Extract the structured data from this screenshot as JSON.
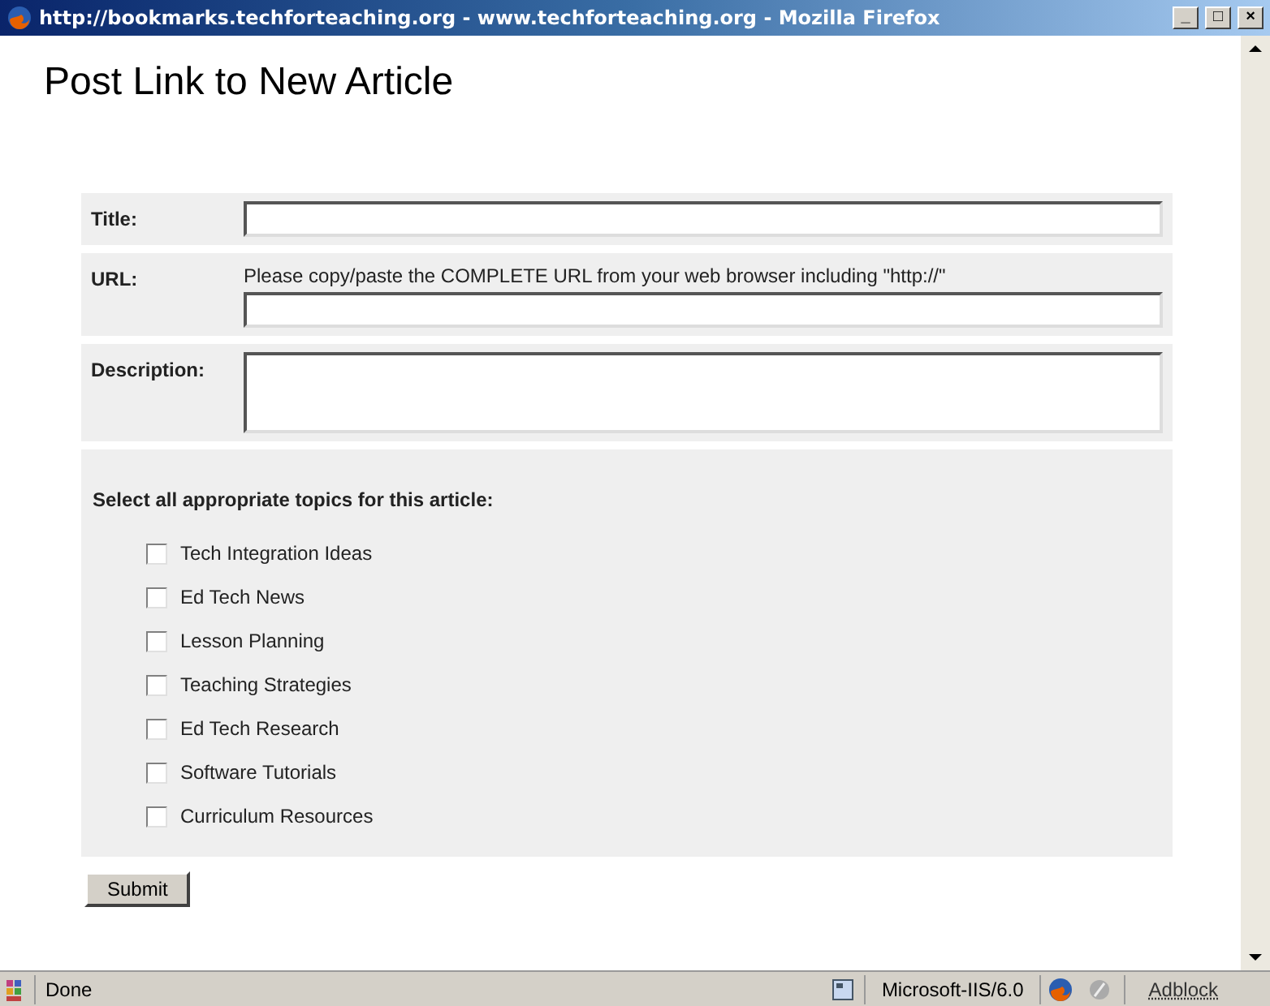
{
  "window": {
    "title": "http://bookmarks.techforteaching.org - www.techforteaching.org - Mozilla Firefox",
    "controls": [
      "_",
      "□",
      "×"
    ]
  },
  "page": {
    "heading": "Post Link to New Article",
    "fields": [
      {
        "kind": "line",
        "label": "Title:"
      },
      {
        "kind": "line",
        "label": "URL:",
        "hint": "Please copy/paste the COMPLETE URL from your web browser including \"http://\""
      },
      {
        "kind": "area",
        "label": "Description:"
      }
    ],
    "topics": {
      "prompt": "Select all appropriate topics for this article:",
      "items": [
        {
          "label": "Tech Integration Ideas",
          "checked": false
        },
        {
          "label": "Ed Tech News",
          "checked": false
        },
        {
          "label": "Lesson Planning",
          "checked": false
        },
        {
          "label": "Teaching Strategies",
          "checked": false
        },
        {
          "label": "Ed Tech Research",
          "checked": false
        },
        {
          "label": "Software Tutorials",
          "checked": false
        },
        {
          "label": "Curriculum Resources",
          "checked": false
        }
      ]
    },
    "submit": "Submit"
  },
  "status_bar": {
    "status": "Done",
    "server": "Microsoft-IIS/6.0",
    "adblock": "Adblock"
  }
}
